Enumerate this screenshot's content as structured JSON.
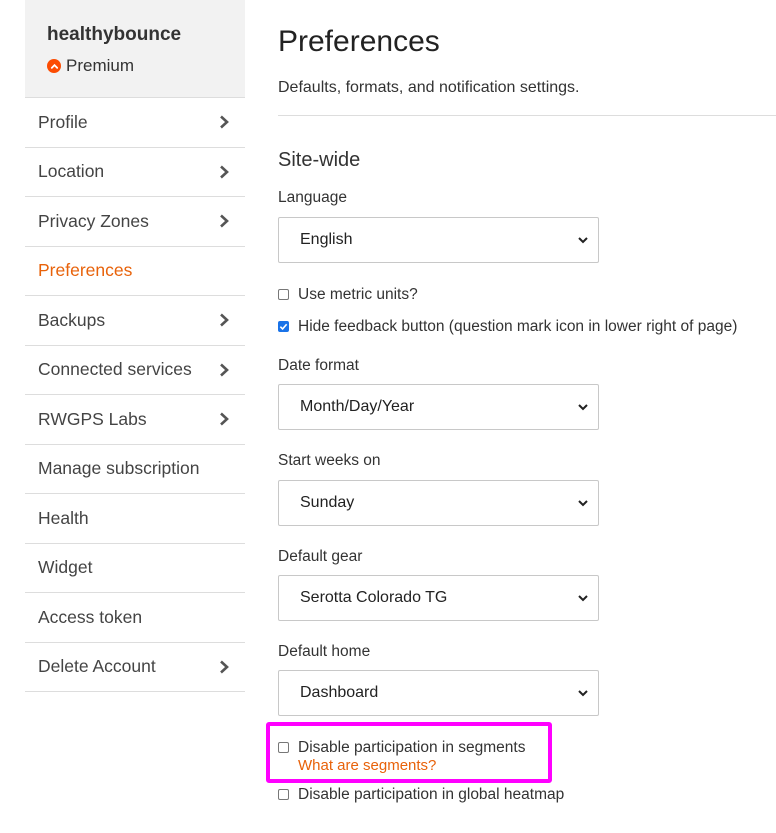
{
  "account": {
    "username": "healthybounce",
    "plan": "Premium"
  },
  "sidebar": {
    "items": [
      {
        "label": "Profile",
        "chevron": true
      },
      {
        "label": "Location",
        "chevron": true
      },
      {
        "label": "Privacy Zones",
        "chevron": true
      },
      {
        "label": "Preferences",
        "chevron": false,
        "active": true
      },
      {
        "label": "Backups",
        "chevron": true
      },
      {
        "label": "Connected services",
        "chevron": true
      },
      {
        "label": "RWGPS Labs",
        "chevron": true
      },
      {
        "label": "Manage subscription",
        "chevron": false
      },
      {
        "label": "Health",
        "chevron": false
      },
      {
        "label": "Widget",
        "chevron": false
      },
      {
        "label": "Access token",
        "chevron": false
      },
      {
        "label": "Delete Account",
        "chevron": true
      }
    ]
  },
  "main": {
    "title": "Preferences",
    "subtitle": "Defaults, formats, and notification settings.",
    "section_title": "Site-wide",
    "language": {
      "label": "Language",
      "value": "English"
    },
    "metric": {
      "label": "Use metric units?",
      "checked": false
    },
    "feedback": {
      "label": "Hide feedback button (question mark icon in lower right of page)",
      "checked": true
    },
    "date_format": {
      "label": "Date format",
      "value": "Month/Day/Year"
    },
    "start_weeks": {
      "label": "Start weeks on",
      "value": "Sunday"
    },
    "default_gear": {
      "label": "Default gear",
      "value": "Serotta Colorado TG"
    },
    "default_home": {
      "label": "Default home",
      "value": "Dashboard"
    },
    "segments": {
      "label": "Disable participation in segments",
      "link": "What are segments?",
      "checked": false
    },
    "heatmap": {
      "label": "Disable participation in global heatmap",
      "checked": false
    }
  },
  "colors": {
    "accent": "#e8620a",
    "highlight": "#ff00ff",
    "checkbox": "#1a73e8"
  }
}
